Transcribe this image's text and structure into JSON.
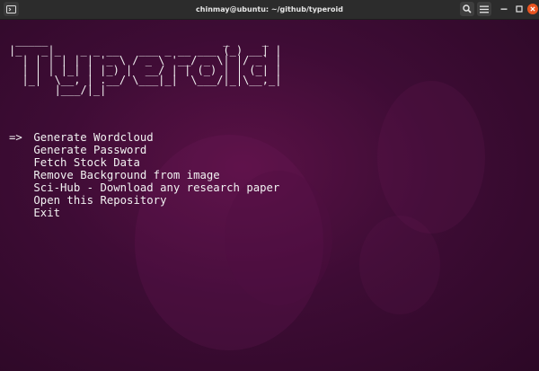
{
  "window": {
    "title": "chinmay@ubuntu: ~/github/typeroid"
  },
  "icons": {
    "new_tab": "new-tab-icon",
    "search": "search-icon",
    "menu": "hamburger-menu-icon",
    "minimize": "minimize-icon",
    "maximize": "maximize-icon",
    "close": "close-icon"
  },
  "colors": {
    "background": "#300a24",
    "close_button": "#e95420",
    "text": "#f2f2f2"
  },
  "terminal": {
    "banner": " _____                           _     _\n|_   _|_   _ _ __   ___ _ __ ___ (_) __| |\n  | | | | | | '_ \\ / _ \\ '__/ _ \\| |/ _` |\n  | | | |_| | |_) |  __/ | | (_) | | (_| |\n  |_|  \\__, | .__/ \\___|_|  \\___/|_|\\__,_|\n       |___/|_|",
    "pointer": "=>",
    "menu": [
      "Generate Wordcloud",
      "Generate Password",
      "Fetch Stock Data",
      "Remove Background from image",
      "Sci-Hub - Download any research paper",
      "Open this Repository",
      "Exit"
    ]
  }
}
